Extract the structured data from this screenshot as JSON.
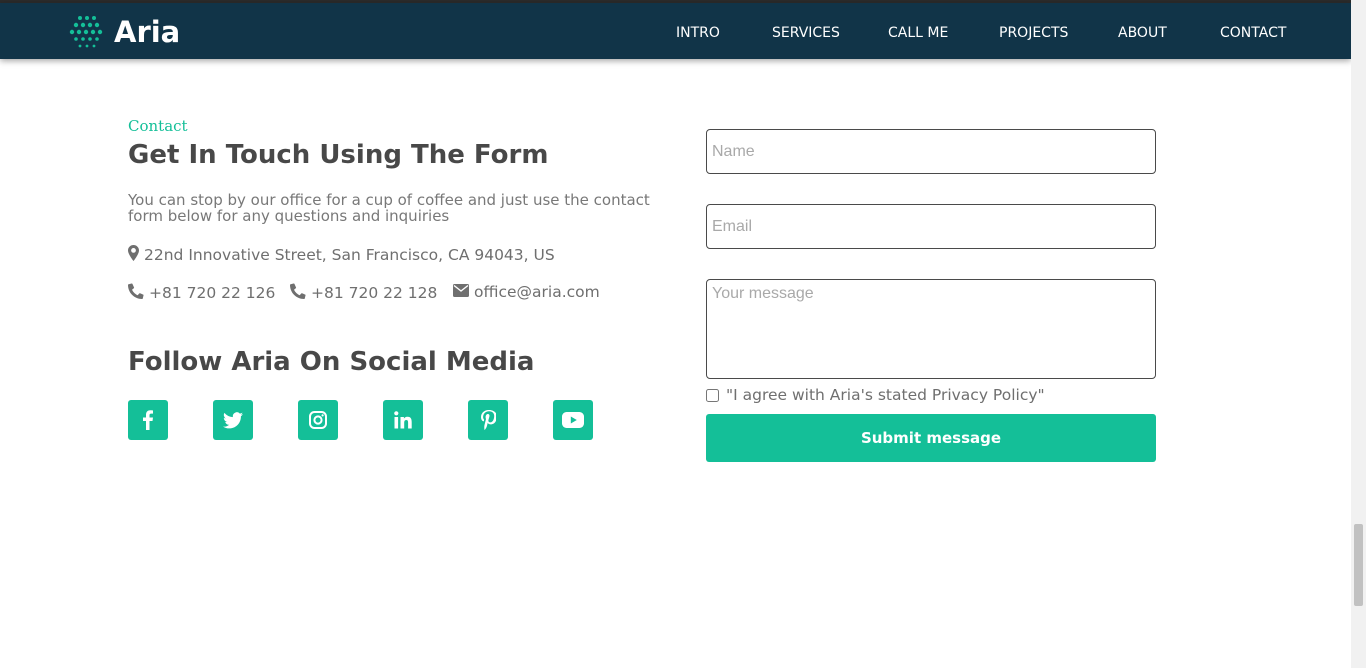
{
  "brand": {
    "name": "Aria",
    "accent": "#14bf98",
    "navbar_bg": "#113448"
  },
  "nav": [
    "INTRO",
    "SERVICES",
    "CALL ME",
    "PROJECTS",
    "ABOUT",
    "CONTACT"
  ],
  "contact": {
    "tag": "Contact",
    "title": "Get In Touch Using The Form",
    "intro": "You can stop by our office for a cup of coffee and just use the contact form below for any questions and inquiries",
    "address": "22nd Innovative Street, San Francisco, CA 94043, US",
    "phone1": "+81 720 22 126",
    "phone2": "+81 720 22 128",
    "email": "office@aria.com"
  },
  "social": {
    "title": "Follow Aria On Social Media",
    "icons": [
      "facebook-icon",
      "twitter-icon",
      "instagram-icon",
      "linkedin-icon",
      "pinterest-icon",
      "youtube-icon"
    ]
  },
  "form": {
    "name_placeholder": "Name",
    "email_placeholder": "Email",
    "message_placeholder": "Your message",
    "agree_label": "\"I agree with Aria's stated Privacy Policy\"",
    "submit_label": "Submit message"
  }
}
